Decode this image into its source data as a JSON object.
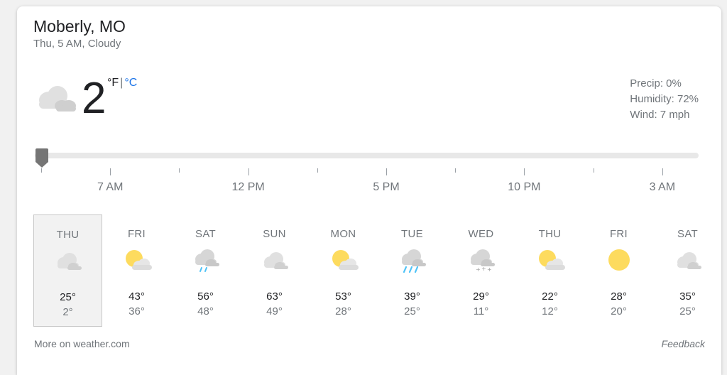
{
  "header": {
    "location": "Moberly, MO",
    "subtitle": "Thu, 5 AM, Cloudy"
  },
  "current": {
    "temperature": "2",
    "unit_f": "°F",
    "unit_sep": "|",
    "unit_c": "°C",
    "icon": "cloudy-icon",
    "precip": "Precip: 0%",
    "humidity": "Humidity: 72%",
    "wind": "Wind: 7 mph"
  },
  "timeline": {
    "slider_position": 0,
    "labels": [
      "7 AM",
      "12 PM",
      "5 PM",
      "10 PM",
      "3 AM"
    ]
  },
  "forecast": [
    {
      "day": "THU",
      "hi": "25°",
      "lo": "2°",
      "icon": "cloudy-icon",
      "selected": true
    },
    {
      "day": "FRI",
      "hi": "43°",
      "lo": "36°",
      "icon": "partly-cloudy-icon"
    },
    {
      "day": "SAT",
      "hi": "56°",
      "lo": "48°",
      "icon": "light-rain-icon"
    },
    {
      "day": "SUN",
      "hi": "63°",
      "lo": "49°",
      "icon": "cloudy-icon"
    },
    {
      "day": "MON",
      "hi": "53°",
      "lo": "28°",
      "icon": "partly-cloudy-icon"
    },
    {
      "day": "TUE",
      "hi": "39°",
      "lo": "25°",
      "icon": "rain-icon"
    },
    {
      "day": "WED",
      "hi": "29°",
      "lo": "11°",
      "icon": "snow-icon"
    },
    {
      "day": "THU",
      "hi": "22°",
      "lo": "12°",
      "icon": "partly-cloudy-icon"
    },
    {
      "day": "FRI",
      "hi": "28°",
      "lo": "20°",
      "icon": "sunny-icon"
    },
    {
      "day": "SAT",
      "hi": "35°",
      "lo": "25°",
      "icon": "cloudy-icon"
    }
  ],
  "footer": {
    "more_link": "More on weather.com",
    "feedback": "Feedback"
  },
  "colors": {
    "accent": "#1a73e8",
    "cloud": "#d5d5d5",
    "sun": "#fddb5e",
    "rain": "#4fc3f7"
  }
}
